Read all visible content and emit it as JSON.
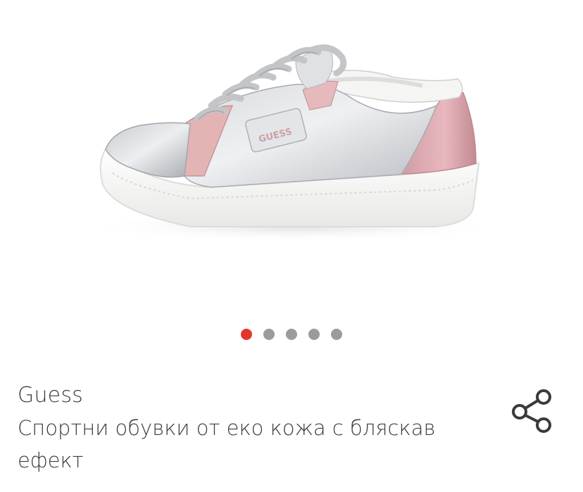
{
  "gallery": {
    "product_image": "sneaker-photo",
    "logo_text": "GUESS",
    "dots": [
      {
        "active": true
      },
      {
        "active": false
      },
      {
        "active": false
      },
      {
        "active": false
      },
      {
        "active": false
      }
    ],
    "active_color": "#e0372c",
    "inactive_color": "#9b9b9b"
  },
  "product": {
    "brand": "Guess",
    "title": "Спортни обувки от еко кожа с бляскав ефект"
  },
  "actions": {
    "share_icon": "share-icon"
  }
}
